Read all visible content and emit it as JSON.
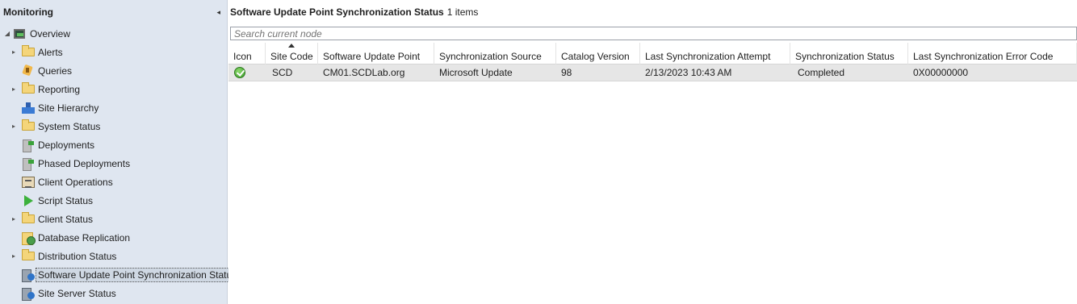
{
  "nav": {
    "title": "Monitoring",
    "collapse_glyph": "◂",
    "items": [
      {
        "label": "Overview",
        "icon": "overview-icon",
        "expander": "◢"
      },
      {
        "label": "Alerts",
        "icon": "folder-icon",
        "expander": "▸"
      },
      {
        "label": "Queries",
        "icon": "query-icon",
        "expander": ""
      },
      {
        "label": "Reporting",
        "icon": "folder-icon",
        "expander": "▸"
      },
      {
        "label": "Site Hierarchy",
        "icon": "site-hierarchy-icon",
        "expander": ""
      },
      {
        "label": "System Status",
        "icon": "folder-icon",
        "expander": "▸"
      },
      {
        "label": "Deployments",
        "icon": "deployment-icon",
        "expander": ""
      },
      {
        "label": "Phased Deployments",
        "icon": "deployment-icon",
        "expander": ""
      },
      {
        "label": "Client Operations",
        "icon": "clipboard-icon",
        "expander": ""
      },
      {
        "label": "Script Status",
        "icon": "play-icon",
        "expander": ""
      },
      {
        "label": "Client Status",
        "icon": "folder-icon",
        "expander": "▸"
      },
      {
        "label": "Database Replication",
        "icon": "database-replication-icon",
        "expander": ""
      },
      {
        "label": "Distribution Status",
        "icon": "folder-icon",
        "expander": "▸"
      },
      {
        "label": "Software Update Point Synchronization Status",
        "icon": "sup-sync-icon",
        "expander": ""
      },
      {
        "label": "Site Server Status",
        "icon": "server-status-icon",
        "expander": ""
      }
    ]
  },
  "main": {
    "title": "Software Update Point Synchronization Status",
    "count": "1 items",
    "search_placeholder": "Search current node",
    "columns": [
      "Icon",
      "Site Code",
      "Software Update Point",
      "Synchronization Source",
      "Catalog Version",
      "Last Synchronization Attempt",
      "Synchronization Status",
      "Last Synchronization Error Code"
    ],
    "rows": [
      {
        "icon": "check-ok-icon",
        "site_code": "SCD",
        "sup": "CM01.SCDLab.org",
        "source": "Microsoft Update",
        "catalog": "98",
        "last_attempt": "2/13/2023 10:43 AM",
        "status": "Completed",
        "error_code": "0X00000000"
      }
    ]
  }
}
